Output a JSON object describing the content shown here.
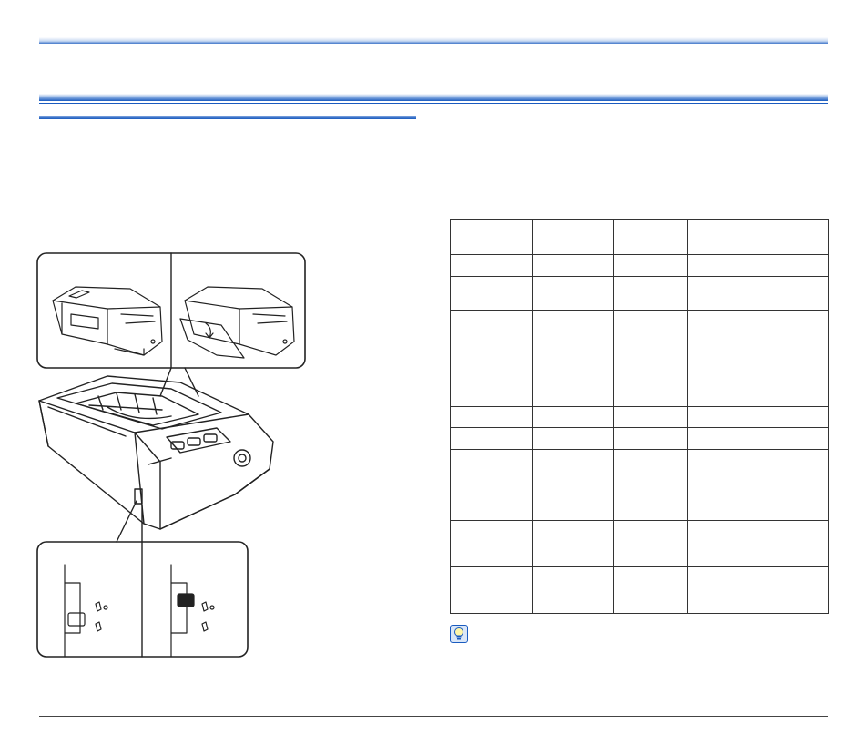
{
  "icons": {
    "hint": "lightbulb-icon"
  },
  "colors": {
    "accent": "#1a5bbf",
    "line": "#222222"
  },
  "table": {
    "columns": 4,
    "rows": 9
  }
}
